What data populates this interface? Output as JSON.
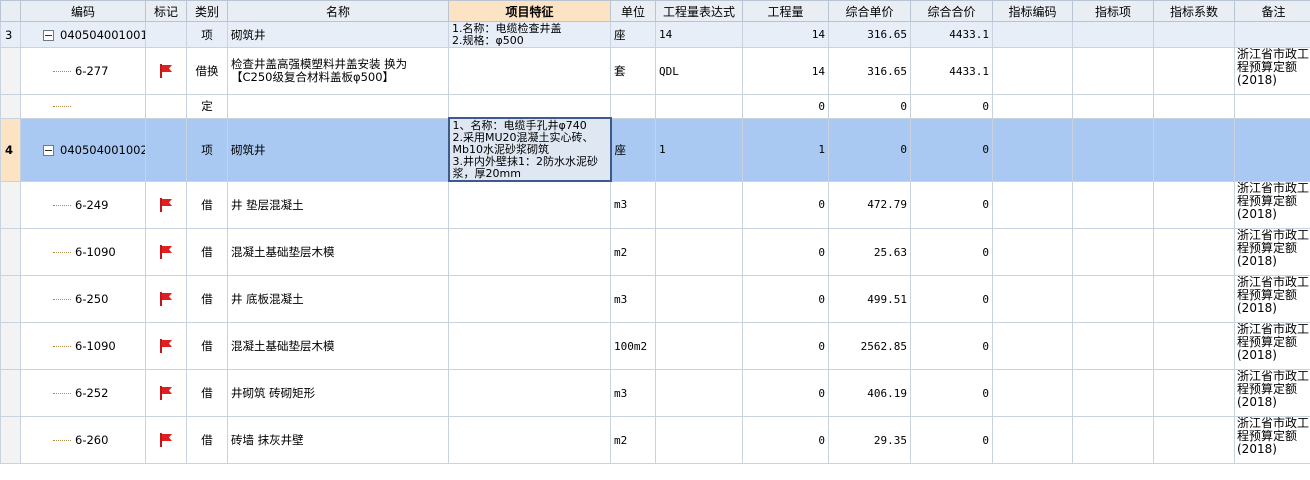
{
  "header": {
    "cols": [
      "",
      "编码",
      "标记",
      "类别",
      "名称",
      "项目特征",
      "单位",
      "工程量表达式",
      "工程量",
      "综合单价",
      "综合合价",
      "指标编码",
      "指标项",
      "指标系数",
      "备注"
    ]
  },
  "colors": {
    "header_bg": "#e9eef5",
    "highlight_header": "#fbe3c4",
    "selected_row": "#a9c9f2",
    "item_row": "#e7eef8",
    "flag": "#e02020"
  },
  "rows": [
    {
      "seq": "3",
      "code": "040504001001",
      "mark": "",
      "type": "项",
      "name": "砌筑井",
      "feature": "1.名称：电缆检查井盖\n2.规格：φ500",
      "unit": "座",
      "expr": "14",
      "qty": "14",
      "price": "316.65",
      "total": "4433.1",
      "idx_code": "",
      "idx_item": "",
      "idx_coef": "",
      "note": ""
    },
    {
      "seq": "",
      "code": "6-277",
      "mark": "flag-icon",
      "type": "借换",
      "name": "检查井盖高强模塑料井盖安装  换为【C250级复合材料盖板φ500】",
      "feature": "",
      "unit": "套",
      "expr": "QDL",
      "qty": "14",
      "price": "316.65",
      "total": "4433.1",
      "idx_code": "",
      "idx_item": "",
      "idx_coef": "",
      "note": "浙江省市政工程预算定额(2018)"
    },
    {
      "seq": "",
      "code": "",
      "mark": "",
      "type": "定",
      "name": "",
      "feature": "",
      "unit": "",
      "expr": "",
      "qty": "0",
      "price": "0",
      "total": "0",
      "idx_code": "",
      "idx_item": "",
      "idx_coef": "",
      "note": ""
    },
    {
      "seq": "4",
      "code": "040504001002",
      "mark": "",
      "type": "项",
      "name": "砌筑井",
      "feature": "1、名称：电缆手孔井φ740\n2.采用MU20混凝土实心砖、Mb10水泥砂浆砌筑\n3.井内外壁抹1：2防水水泥砂浆，厚20mm",
      "unit": "座",
      "expr": "1",
      "qty": "1",
      "price": "0",
      "total": "0",
      "idx_code": "",
      "idx_item": "",
      "idx_coef": "",
      "note": ""
    },
    {
      "seq": "",
      "code": "6-249",
      "mark": "flag-icon",
      "type": "借",
      "name": "井 垫层混凝土",
      "feature": "",
      "unit": "m3",
      "expr": "",
      "qty": "0",
      "price": "472.79",
      "total": "0",
      "idx_code": "",
      "idx_item": "",
      "idx_coef": "",
      "note": "浙江省市政工程预算定额(2018)"
    },
    {
      "seq": "",
      "code": "6-1090",
      "mark": "flag-icon",
      "type": "借",
      "name": "混凝土基础垫层木模",
      "feature": "",
      "unit": "m2",
      "expr": "",
      "qty": "0",
      "price": "25.63",
      "total": "0",
      "idx_code": "",
      "idx_item": "",
      "idx_coef": "",
      "note": "浙江省市政工程预算定额(2018)"
    },
    {
      "seq": "",
      "code": "6-250",
      "mark": "flag-icon",
      "type": "借",
      "name": "井 底板混凝土",
      "feature": "",
      "unit": "m3",
      "expr": "",
      "qty": "0",
      "price": "499.51",
      "total": "0",
      "idx_code": "",
      "idx_item": "",
      "idx_coef": "",
      "note": "浙江省市政工程预算定额(2018)"
    },
    {
      "seq": "",
      "code": "6-1090",
      "mark": "flag-icon",
      "type": "借",
      "name": "混凝土基础垫层木模",
      "feature": "",
      "unit": "100m2",
      "expr": "",
      "qty": "0",
      "price": "2562.85",
      "total": "0",
      "idx_code": "",
      "idx_item": "",
      "idx_coef": "",
      "note": "浙江省市政工程预算定额(2018)"
    },
    {
      "seq": "",
      "code": "6-252",
      "mark": "flag-icon",
      "type": "借",
      "name": "井砌筑 砖砌矩形",
      "feature": "",
      "unit": "m3",
      "expr": "",
      "qty": "0",
      "price": "406.19",
      "total": "0",
      "idx_code": "",
      "idx_item": "",
      "idx_coef": "",
      "note": "浙江省市政工程预算定额(2018)"
    },
    {
      "seq": "",
      "code": "6-260",
      "mark": "flag-icon",
      "type": "借",
      "name": "砖墙 抹灰井壁",
      "feature": "",
      "unit": "m2",
      "expr": "",
      "qty": "0",
      "price": "29.35",
      "total": "0",
      "idx_code": "",
      "idx_item": "",
      "idx_coef": "",
      "note": "浙江省市政工程预算定额(2018)"
    }
  ]
}
